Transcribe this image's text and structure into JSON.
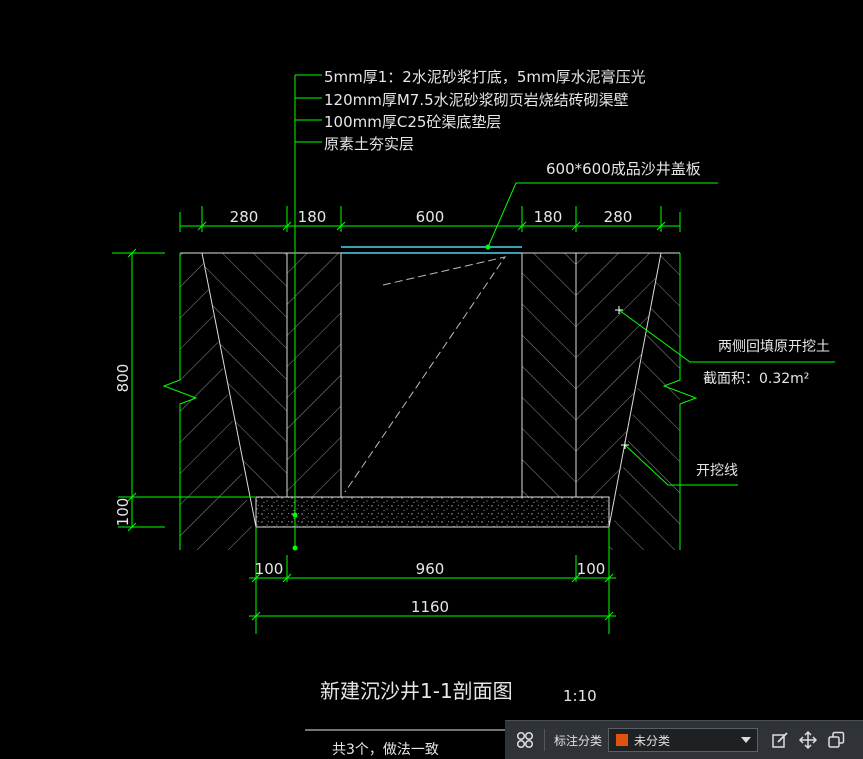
{
  "drawing": {
    "layers": [
      "5mm厚1：2水泥砂浆打底，5mm厚水泥膏压光",
      "120mm厚M7.5水泥砂浆砌页岩烧结砖砌渠壁",
      "100mm厚C25砼渠底垫层",
      "原素土夯实层"
    ],
    "cover_label": "600*600成品沙井盖板",
    "top_dims": [
      "280",
      "180",
      "600",
      "180",
      "280"
    ],
    "left_dims": [
      "800",
      "100"
    ],
    "bottom_dims": [
      "100",
      "960",
      "100"
    ],
    "total_width": "1160",
    "backfill_label": "两侧回填原开挖土",
    "section_area": "截面积：0.32m²",
    "excavation_label": "开挖线",
    "title": "新建沉沙井1-1剖面图",
    "scale": "1:10",
    "note": "共3个，做法一致"
  },
  "toolbar": {
    "label": "标注分类",
    "select_value": "未分类",
    "swatch_color": "#e0520f"
  },
  "colors": {
    "dimension": "#00ff00",
    "text": "#e6e6e6",
    "cover": "#4fd2e8",
    "background": "#000000"
  }
}
